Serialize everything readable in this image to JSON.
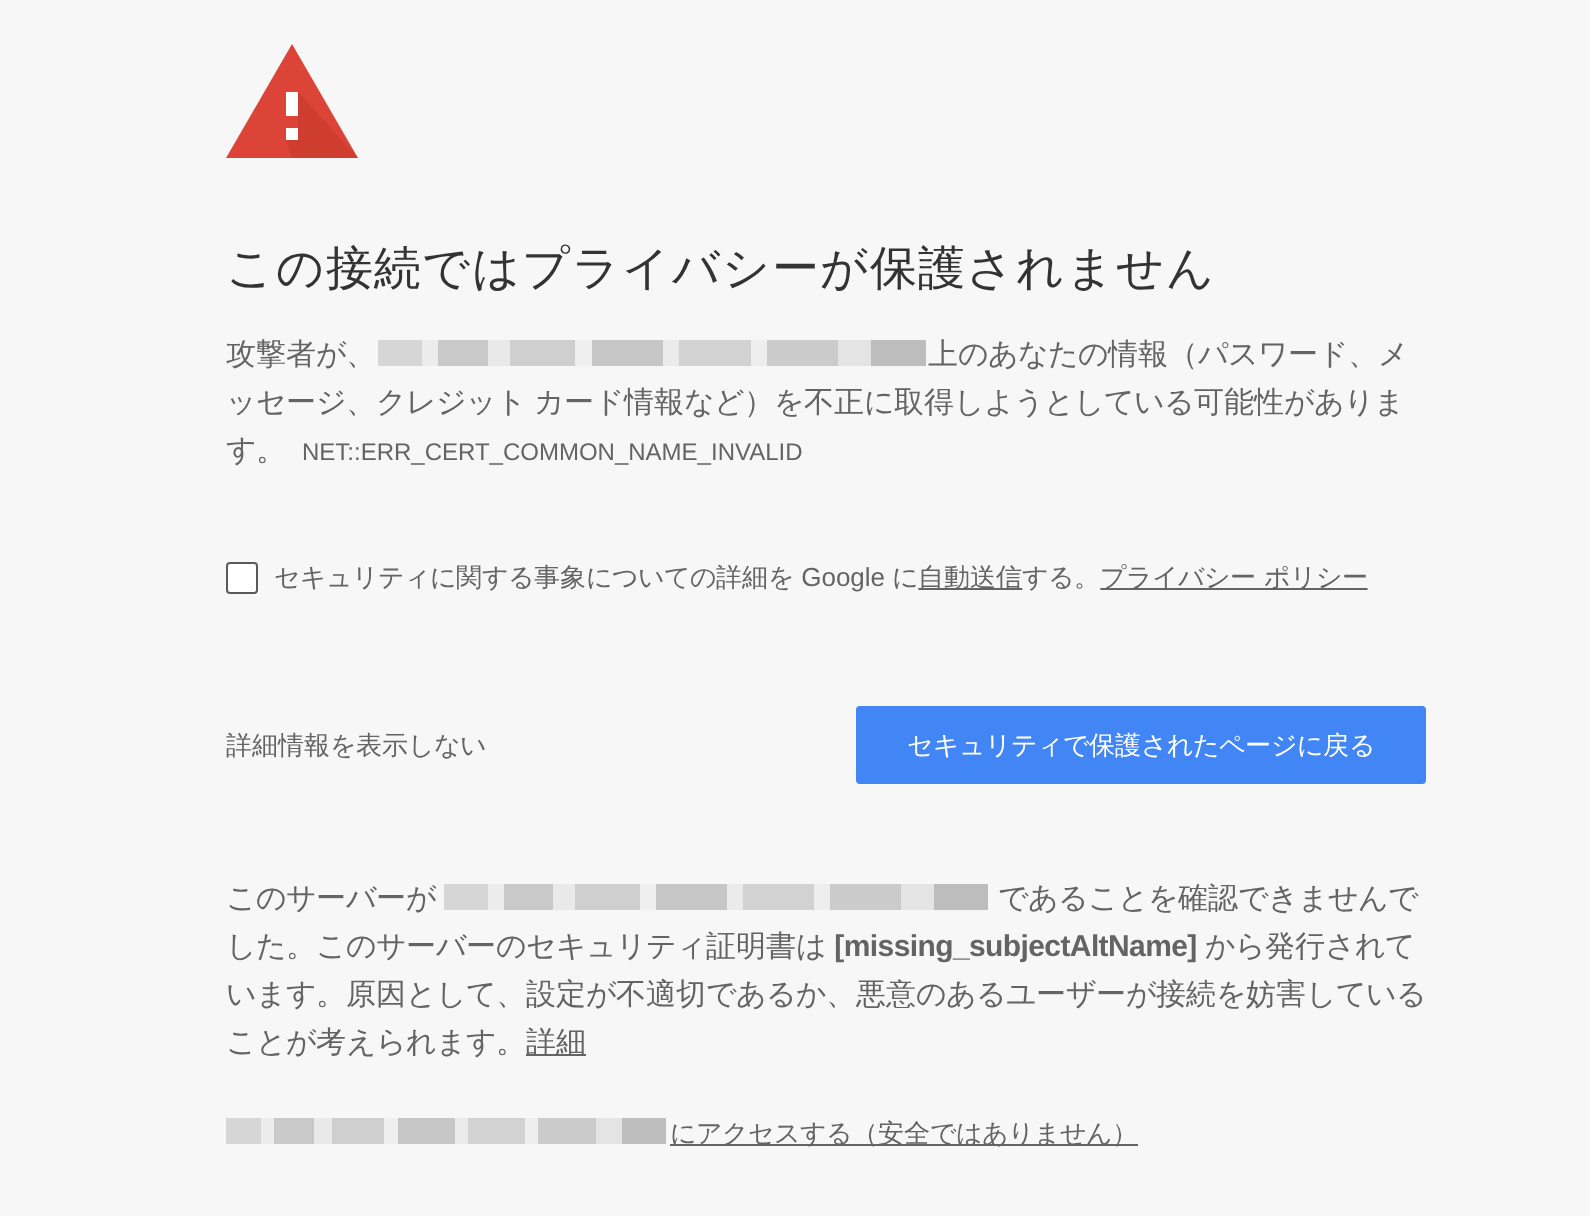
{
  "title": "この接続ではプライバシーが保護されません",
  "intro": {
    "segments": [
      {
        "kind": "text",
        "text": "攻撃者が、"
      },
      {
        "kind": "redacted"
      },
      {
        "kind": "text",
        "text": "上のあなたの情報（パスワード、メッセージ、クレジット カード情報など）を不正に取得しようとしている可能性があります。"
      }
    ],
    "error_code": "NET::ERR_CERT_COMMON_NAME_INVALID"
  },
  "report_option": {
    "checked": false,
    "segments": [
      {
        "kind": "text",
        "text": "セキュリティに関する事象についての詳細を Google に"
      },
      {
        "kind": "link",
        "text": "自動送信"
      },
      {
        "kind": "text",
        "text": "する。"
      },
      {
        "kind": "link",
        "text": "プライバシー ポリシー"
      }
    ]
  },
  "details_toggle": "詳細情報を表示しない",
  "back_button": "セキュリティで保護されたページに戻る",
  "details": {
    "segments": [
      {
        "kind": "text",
        "text": "このサーバーが"
      },
      {
        "kind": "redacted"
      },
      {
        "kind": "text",
        "text": "であることを確認できませんでした。このサーバーのセキュリティ証明書は **[missing_subjectAltName]** から発行されています。原因として、設定が不適切であるか、悪意のあるユーザーが接続を妨害していることが考えられます。"
      },
      {
        "kind": "link",
        "text": "詳細"
      }
    ]
  },
  "proceed": {
    "segments": [
      {
        "kind": "redacted"
      },
      {
        "kind": "link",
        "text": "にアクセスする（安全ではありません）"
      }
    ]
  }
}
